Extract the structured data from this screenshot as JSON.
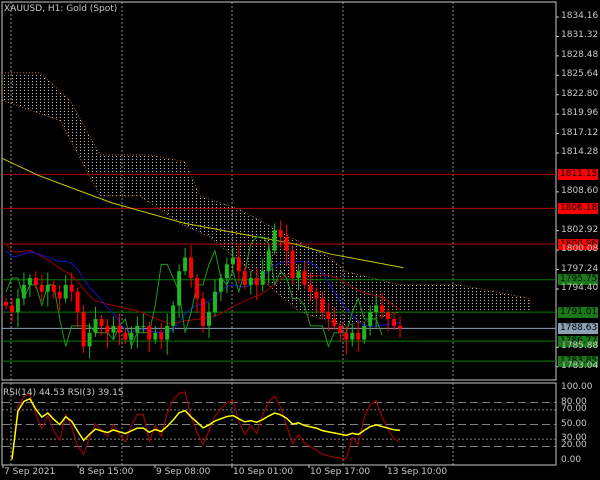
{
  "window": {
    "title": "XAUUSD, H1:  Gold (Spot)"
  },
  "rsi_panel": {
    "label": "RSI(14) 44.53 RSI(3) 39.15"
  },
  "colors": {
    "bull": "#21b521",
    "bear": "#ff0000",
    "ma_yellow": "#c8c800",
    "ma_blue": "#1414c8",
    "ma_red": "#a00000",
    "line_green": "#1e9a1e",
    "cloud": "#c8c8c8",
    "level_red": "#ff0000",
    "level_green": "#008000",
    "level_grey": "#8ca0b4"
  },
  "chart_data": {
    "type": "candlestick",
    "symbol": "XAUUSD",
    "timeframe": "H1",
    "y_ticks": [
      "1834.16",
      "1831.32",
      "1828.48",
      "1825.64",
      "1822.80",
      "1819.96",
      "1817.12",
      "1814.28",
      "1808.60",
      "1802.92",
      "1800.08",
      "1797.24",
      "1794.40",
      "1785.88",
      "1783.04"
    ],
    "price_tags": [
      {
        "value": "1811.15",
        "kind": "red"
      },
      {
        "value": "1806.18",
        "kind": "red"
      },
      {
        "value": "1800.96",
        "kind": "red"
      },
      {
        "value": "1795.75",
        "kind": "green"
      },
      {
        "value": "1791.01",
        "kind": "green"
      },
      {
        "value": "1788.63",
        "kind": "grey"
      },
      {
        "value": "1786.77",
        "kind": "green"
      },
      {
        "value": "1783.85",
        "kind": "green"
      }
    ],
    "x_labels": [
      "7 Sep 2021",
      "8 Sep 15:00",
      "9 Sep 08:00",
      "10 Sep 01:00",
      "10 Sep 17:00",
      "13 Sep 10:00"
    ],
    "closes": [
      1792,
      1791,
      1793,
      1795,
      1796,
      1795,
      1794,
      1795,
      1794,
      1793,
      1795,
      1794,
      1791,
      1786,
      1788,
      1790,
      1789,
      1788,
      1789,
      1788,
      1787,
      1788,
      1789,
      1789,
      1787,
      1788,
      1787,
      1789,
      1792,
      1797,
      1799,
      1796,
      1793,
      1789,
      1791,
      1794,
      1796,
      1798,
      1799,
      1797,
      1795,
      1796,
      1795,
      1797,
      1800,
      1803,
      1802,
      1800,
      1796,
      1797,
      1795,
      1794,
      1793,
      1791,
      1790,
      1789,
      1788,
      1787,
      1788,
      1787,
      1789,
      1791,
      1792,
      1791,
      1790,
      1789,
      1788.63
    ],
    "slow_ma": [
      1813.5,
      1811,
      1809,
      1807,
      1805.5,
      1804,
      1803,
      1802,
      1801,
      1799.5,
      1798.5,
      1797.5
    ],
    "rsi_levels": [
      "100.00",
      "80.00",
      "70.00",
      "50.00",
      "30.00",
      "20.00",
      "0.00"
    ],
    "rsi_last": {
      "rsi14": 44.53,
      "rsi3": 39.15
    }
  }
}
